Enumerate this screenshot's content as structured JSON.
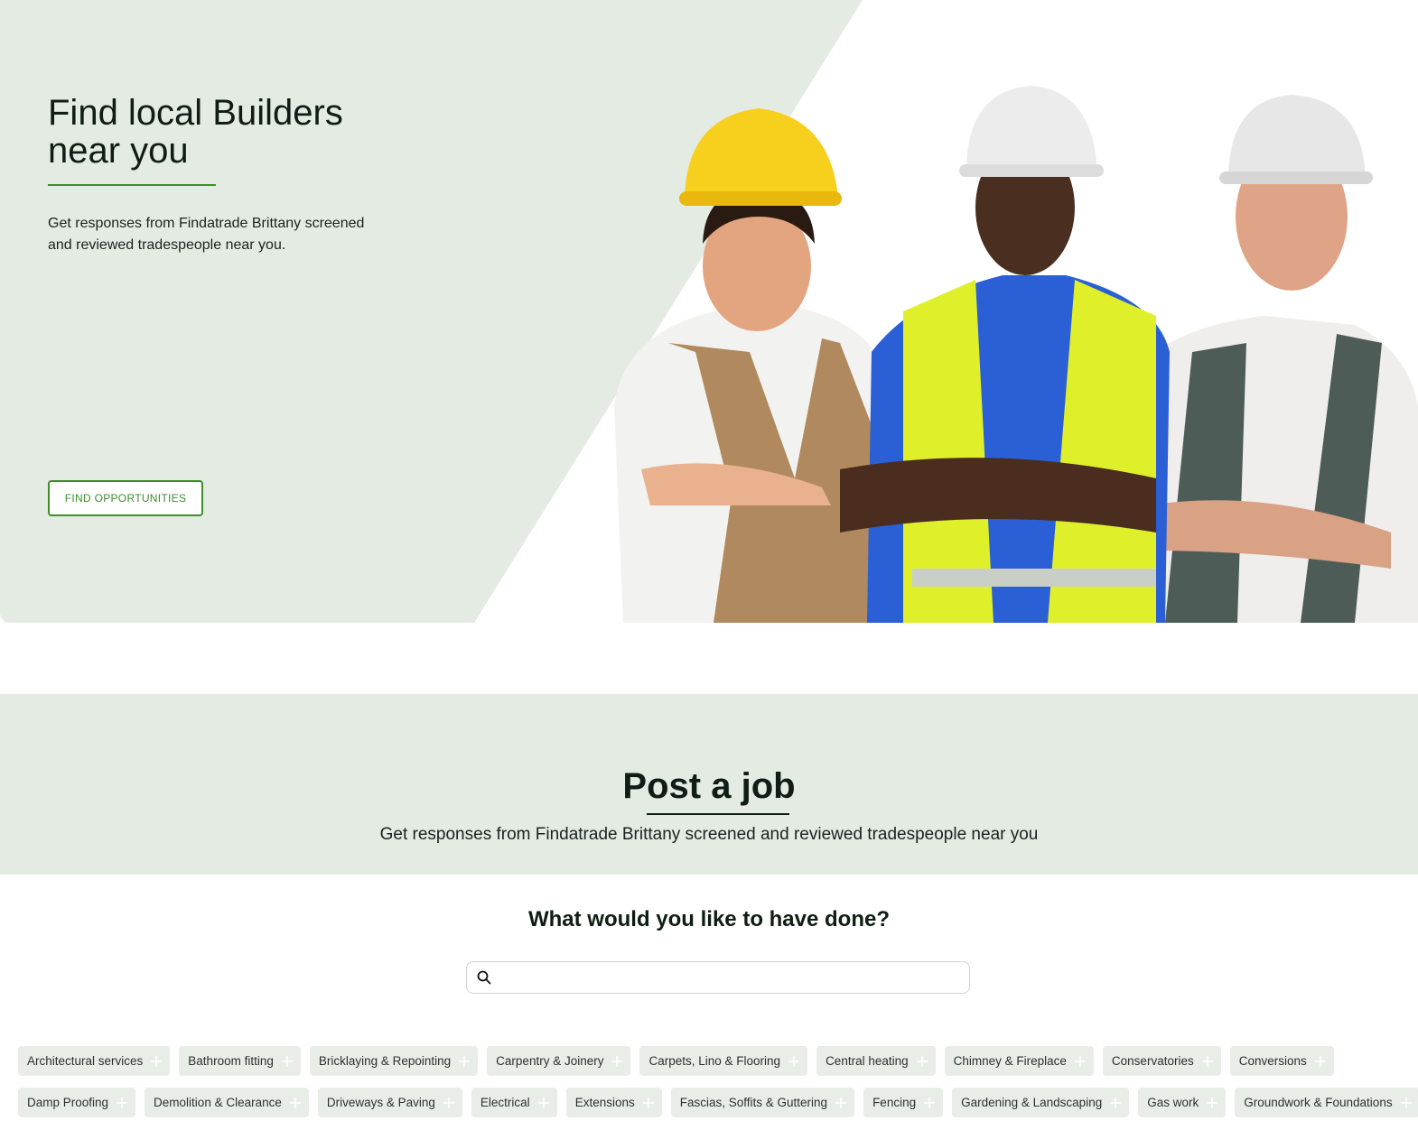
{
  "hero": {
    "title_line1": "Find local Builders",
    "title_line2": "near you",
    "subtitle": "Get responses from Findatrade Brittany screened and reviewed tradespeople near you.",
    "button_label": "FIND OPPORTUNITIES",
    "image_alt": "Three builders in hard hats with arms crossed"
  },
  "post_job": {
    "title": "Post a job",
    "subtitle": "Get responses from Findatrade Brittany screened and reviewed tradespeople near you"
  },
  "search": {
    "question": "What would you like to have done?",
    "value": "",
    "placeholder": ""
  },
  "categories": {
    "row1": [
      "Architectural services",
      "Bathroom fitting",
      "Bricklaying & Repointing",
      "Carpentry & Joinery",
      "Carpets, Lino & Flooring",
      "Central heating",
      "Chimney & Fireplace",
      "Conservatories",
      "Conversions"
    ],
    "row2": [
      "Damp Proofing",
      "Demolition & Clearance",
      "Driveways & Paving",
      "Electrical",
      "Extensions",
      "Fascias, Soffits & Guttering",
      "Fencing",
      "Gardening & Landscaping",
      "Gas work",
      "Groundwork & Foundations"
    ]
  },
  "colors": {
    "accent_green": "#3e8e2a",
    "hero_bg": "#e4ebe2",
    "chip_bg": "#e9ede8"
  },
  "icons": {
    "search": "search-icon",
    "add": "plus-icon"
  }
}
